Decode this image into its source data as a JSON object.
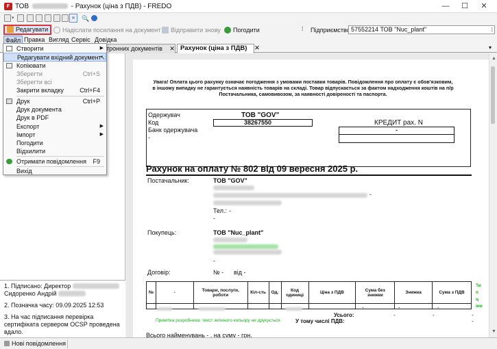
{
  "window": {
    "title_prefix": "ТОВ",
    "title_suffix": "- Рахунок (ціна з ПДВ) - FREDO",
    "minimize": "—",
    "maximize": "☐",
    "close": "✕"
  },
  "toolbar": {
    "edit_label": "Редагувати",
    "send_link_label": "Надіслати посилання на документ",
    "resend_label": "Відправити знову",
    "agree_label": "Погодити",
    "enterprise_label": "Підприємство",
    "enterprise_value": "57552214  ТОВ \"Nuc_plant\""
  },
  "menubar": {
    "file": "Файл",
    "edit": "Правка",
    "view": "Вигляд",
    "service": "Сервіс",
    "help": "Довідка"
  },
  "tabs": {
    "background_tab": "тронних документів",
    "active_tab": "Рахунок (ціна з ПДВ)",
    "close": "✕"
  },
  "file_menu": {
    "items": [
      {
        "label": "Створити",
        "shortcut": "",
        "submenu": true
      },
      {
        "label": "Редагувати вхідний документ",
        "shortcut": ""
      },
      {
        "label": "Копіювати",
        "shortcut": ""
      },
      {
        "label": "Зберегти",
        "shortcut": "Ctrl+S"
      },
      {
        "label": "Зберегти всі",
        "shortcut": ""
      },
      {
        "label": "Закрити вкладку",
        "shortcut": "Ctrl+F4"
      },
      {
        "label": "Друк",
        "shortcut": "Ctrl+P"
      },
      {
        "label": "Друк документа",
        "shortcut": ""
      },
      {
        "label": "Друк в PDF",
        "shortcut": ""
      },
      {
        "label": "Експорт",
        "shortcut": "",
        "submenu": true
      },
      {
        "label": "Імпорт",
        "shortcut": "",
        "submenu": true
      },
      {
        "label": "Погодити",
        "shortcut": ""
      },
      {
        "label": "Відхилити",
        "shortcut": ""
      },
      {
        "label": "Отримати повідомлення",
        "shortcut": "F9"
      },
      {
        "label": "Вихід",
        "shortcut": ""
      }
    ]
  },
  "sign_info": {
    "line1_prefix": "1. Підписано: Директор",
    "line1_name": "Сидоренко Андрій",
    "line2": "2. Позначка часу: 09.09.2025 12:53",
    "line3": "3. На час підписання перевірка сертифіката сервером OCSP проведена вдало."
  },
  "document": {
    "notice": "Увага! Оплата цього рахунку означає погодження з умовами поставки товарів. Повідомлення про оплату є обов'язковим, в іншому випадку не гарантується  наявність товарів на складі. Товар відпускається за фактом надходження  коштів на п/р Постачальника, самовивозом, за наявності довіреності та паспорта.",
    "receiver_label": "Одержувач",
    "code_label": "Код",
    "bank_label": "Банк одержувача",
    "dash": "-",
    "receiver_name": "ТОВ \"GOV\"",
    "receiver_code": "38267550",
    "credit_label": "КРЕДИТ рах. N",
    "credit_value": "-",
    "invoice_title": "Рахунок на оплату № 802 від 09 вересня 2025 р.",
    "supplier_label": "Постачальник:",
    "supplier_name": "ТОВ \"GOV\"",
    "supplier_phone_label": "Тел.:",
    "buyer_label": "Покупець:",
    "buyer_name": "ТОВ \"Nuc_plant\"",
    "contract_label": "Договір:",
    "contract_value": "№ -",
    "contract_date": "від -",
    "table_headers": [
      "№",
      "-",
      "Товари, послуги, роботи",
      "Кіл-сть",
      "Од.",
      "Код одиниці",
      "Ціна з ПДВ",
      "Сума без знижки",
      "Знижка",
      "Сума з ПДВ"
    ],
    "side_green_headers": [
      "Ти",
      "п",
      "ц",
      "іни"
    ],
    "row_dashes": [
      "-",
      "-",
      "-"
    ],
    "developer_note": "Примітка розробника: текст зеленого кольору не друкується",
    "total_label": "Усього:",
    "vat_label": "У тому числі ПДВ:",
    "total_dash": "-",
    "total_items_line": "Всього найменувань - , на суму -  грн."
  },
  "status": {
    "text": "Нові повідомлення"
  }
}
